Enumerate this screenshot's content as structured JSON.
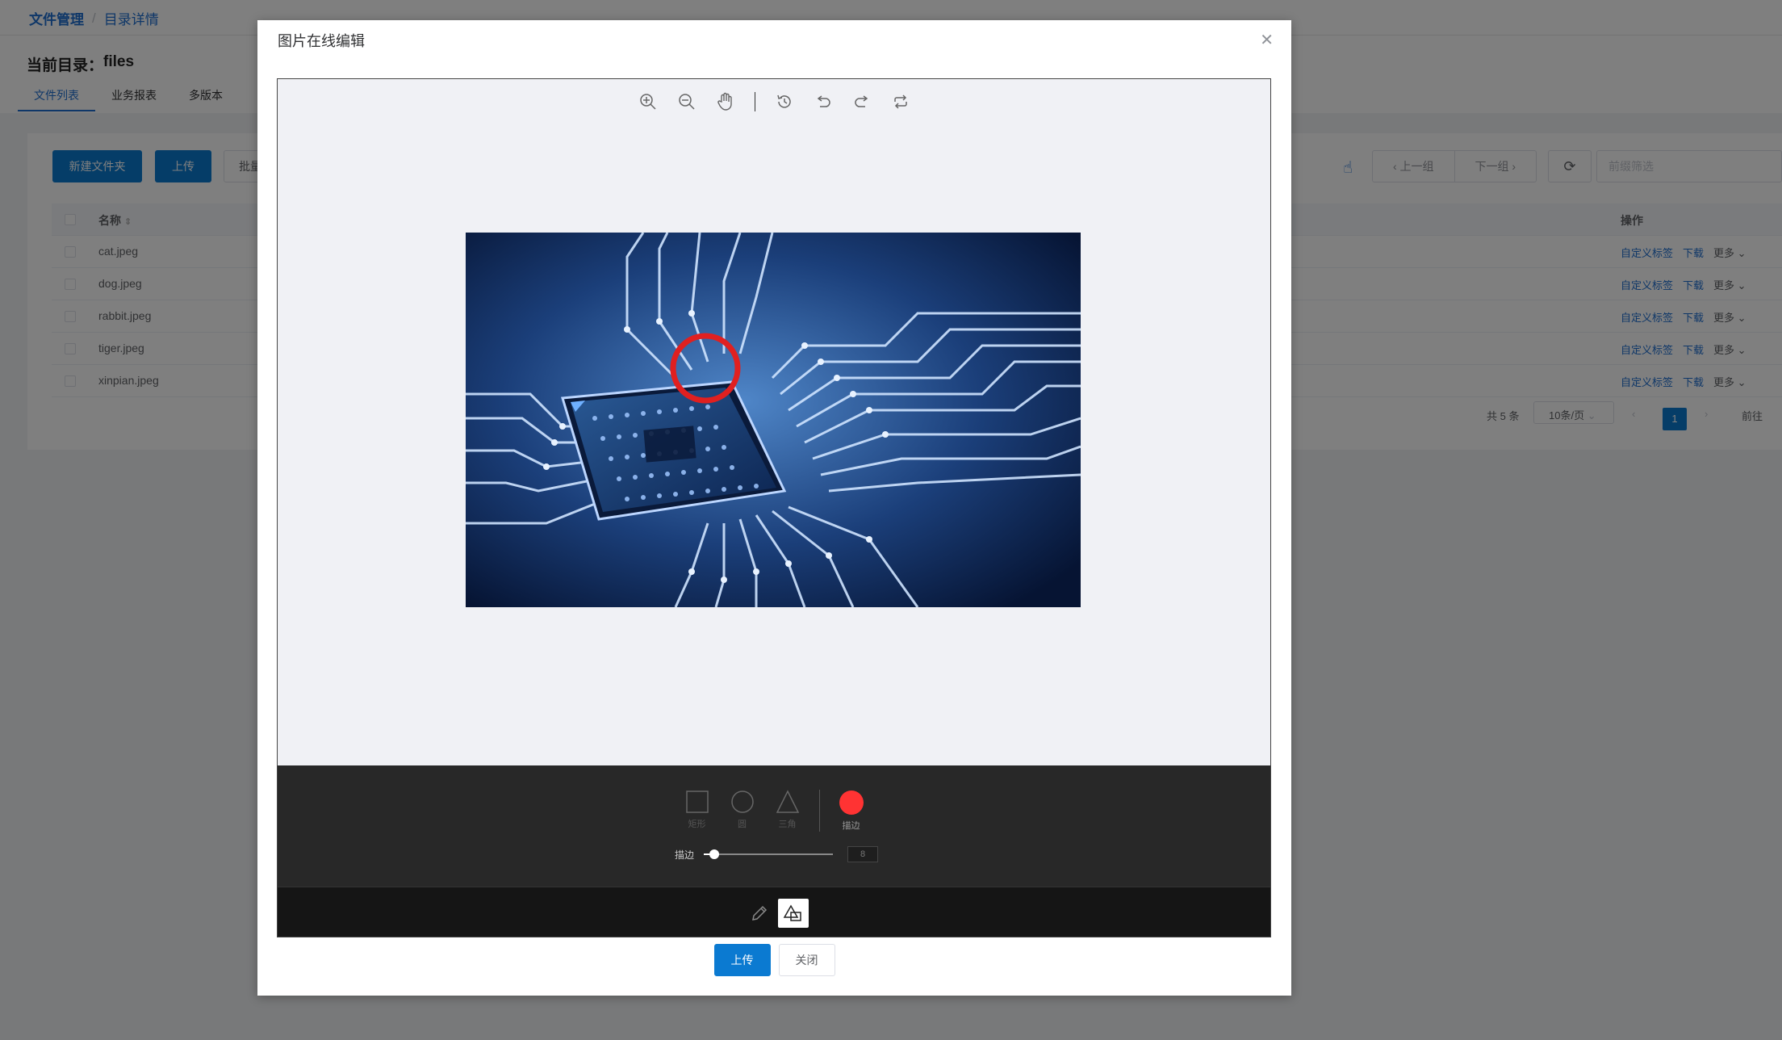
{
  "breadcrumb": {
    "root": "文件管理",
    "separator": "/",
    "current": "目录详情"
  },
  "current_dir": {
    "label": "当前目录：",
    "value": "files"
  },
  "tabs": [
    {
      "label": "文件列表",
      "active": true
    },
    {
      "label": "业务报表",
      "active": false
    },
    {
      "label": "多版本",
      "active": false
    }
  ],
  "toolbar": {
    "new_folder": "新建文件夹",
    "upload": "上传",
    "batch_partial": "批量",
    "prev_group": "上一组",
    "next_group": "下一组",
    "filter_placeholder": "前缀筛选"
  },
  "table": {
    "headers": {
      "name": "名称",
      "ops": "操作"
    },
    "rows": [
      {
        "name": "cat.jpeg"
      },
      {
        "name": "dog.jpeg"
      },
      {
        "name": "rabbit.jpeg"
      },
      {
        "name": "tiger.jpeg"
      },
      {
        "name": "xinpian.jpeg"
      }
    ],
    "op_labels": {
      "tag": "自定义标签",
      "download": "下载",
      "more": "更多"
    }
  },
  "pagination": {
    "total": "共 5 条",
    "page_size": "10条/页",
    "current_page": "1",
    "goto": "前往"
  },
  "dialog": {
    "title": "图片在线编辑",
    "shape_labels": {
      "rect": "矩形",
      "circle": "圆",
      "triangle": "三角",
      "stroke": "描边"
    },
    "stroke_color": "#ff3333",
    "slider_label": "描边",
    "stroke_value": "8",
    "stroke_fraction": 0.08,
    "upload_button": "上传",
    "close_button": "关闭"
  },
  "colors": {
    "primary": "#0b7ad1",
    "link": "#1f6fd1",
    "editor_panel": "#282828",
    "annotation": "#e02020"
  }
}
